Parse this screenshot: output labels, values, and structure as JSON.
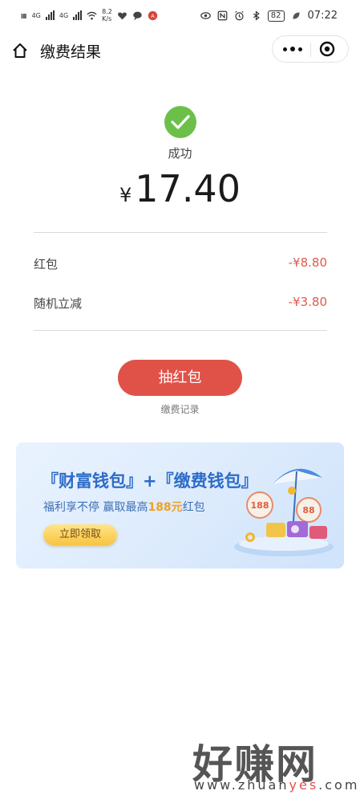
{
  "status_bar": {
    "net_speed": "8.2",
    "net_unit": "K/s",
    "network_left": "4G",
    "network_right": "4G",
    "battery": "82",
    "time": "07:22"
  },
  "header": {
    "title": "缴费结果"
  },
  "result": {
    "status": "成功",
    "currency": "¥",
    "amount": "17.40",
    "discounts": [
      {
        "label": "红包",
        "value": "-¥8.80"
      },
      {
        "label": "随机立减",
        "value": "-¥3.80"
      }
    ],
    "action_label": "抽红包",
    "history_link": "缴费记录"
  },
  "banner": {
    "title": "『财富钱包』+『缴费钱包』",
    "subtitle_prefix": "福利享不停 赢取最高",
    "subtitle_highlight": "188元",
    "subtitle_suffix": "红包",
    "cta": "立即领取",
    "badge_left": "188",
    "badge_right": "88"
  },
  "watermark": {
    "logo": "好赚网",
    "url_prefix": "www.zhuan",
    "url_highlight": "yes",
    "url_suffix": ".com"
  },
  "colors": {
    "accent_red": "#e05248",
    "success_green": "#6cc04a",
    "banner_blue": "#2d6cc8"
  }
}
